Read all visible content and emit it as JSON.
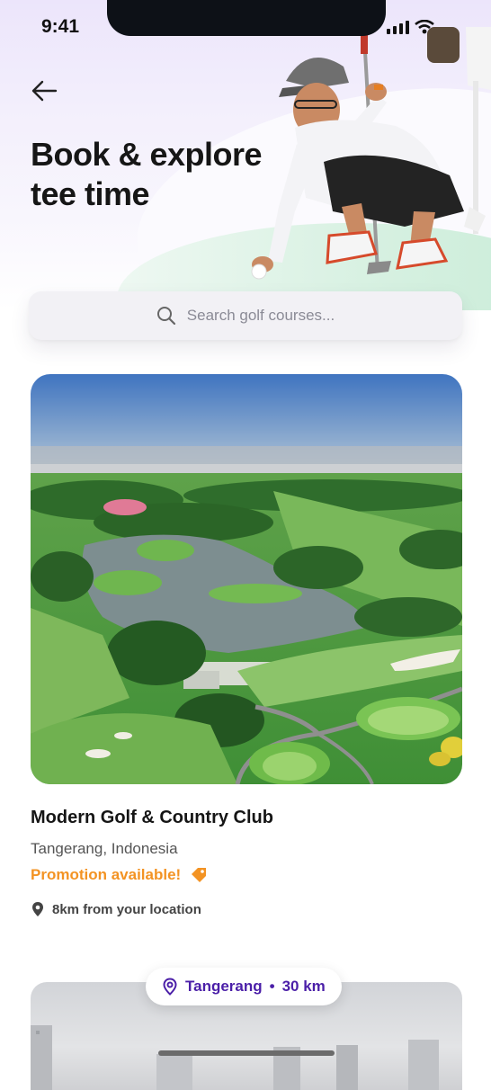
{
  "status": {
    "time": "9:41"
  },
  "header": {
    "title_line1": "Book & explore",
    "title_line2": "tee time"
  },
  "search": {
    "placeholder": "Search golf courses..."
  },
  "course": {
    "name": "Modern Golf & Country Club",
    "location": "Tangerang, Indonesia",
    "promo": "Promotion available!",
    "distance": "8km from your location"
  },
  "next_card": {
    "chip_city": "Tangerang",
    "chip_separator": "•",
    "chip_distance": "30 km"
  },
  "colors": {
    "accent_orange": "#f39323",
    "accent_purple": "#4b1fa8",
    "text_dark": "#151515"
  },
  "icons": [
    "back-arrow-icon",
    "search-icon",
    "tag-icon",
    "location-pin-icon",
    "map-pin-outline-icon"
  ]
}
